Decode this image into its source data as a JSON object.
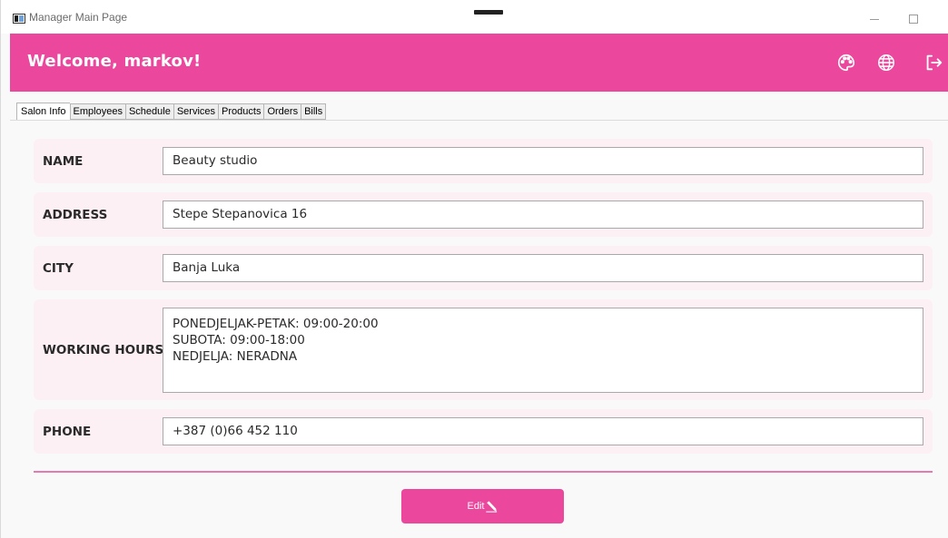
{
  "window": {
    "title": "Manager Main Page",
    "minimize_glyph": "—",
    "maximize_glyph": "□"
  },
  "header": {
    "welcome": "Welcome, markov!",
    "icons": [
      "palette-icon",
      "globe-icon",
      "logout-icon"
    ],
    "background": "#ea479d"
  },
  "tabs": [
    {
      "label": "Salon Info",
      "active": true
    },
    {
      "label": "Employees",
      "active": false
    },
    {
      "label": "Schedule",
      "active": false
    },
    {
      "label": "Services",
      "active": false
    },
    {
      "label": "Products",
      "active": false
    },
    {
      "label": "Orders",
      "active": false
    },
    {
      "label": "Bills",
      "active": false
    }
  ],
  "form": {
    "name": {
      "label": "NAME",
      "value": "Beauty studio"
    },
    "address": {
      "label": "ADDRESS",
      "value": "Stepe Stepanovica 16"
    },
    "city": {
      "label": "CITY",
      "value": "Banja Luka"
    },
    "working_hours": {
      "label": "WORKING HOURS",
      "value": "PONEDJELJAK-PETAK: 09:00-20:00\nSUBOTA: 09:00-18:00\nNEDJELJA: NERADNA"
    },
    "phone": {
      "label": "PHONE",
      "value": "+387 (0)66 452 110"
    }
  },
  "actions": {
    "edit_label": "Edit",
    "edit_icon": "pencil-icon"
  },
  "colors": {
    "accent": "#ea479d",
    "row_background": "#fcf0f5",
    "separator": "#e47ab2"
  }
}
